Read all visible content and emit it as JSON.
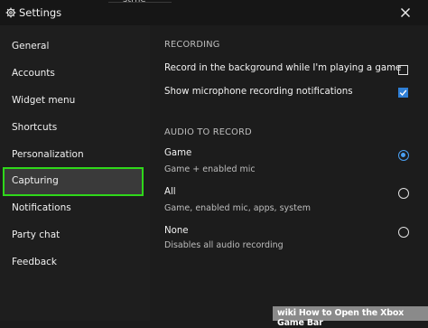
{
  "window": {
    "title": "Settings",
    "top_cut_text": "strne"
  },
  "sidebar": {
    "items": [
      {
        "label": "General"
      },
      {
        "label": "Accounts"
      },
      {
        "label": "Widget menu"
      },
      {
        "label": "Shortcuts"
      },
      {
        "label": "Personalization"
      },
      {
        "label": "Capturing",
        "selected": true
      },
      {
        "label": "Notifications"
      },
      {
        "label": "Party chat"
      },
      {
        "label": "Feedback"
      }
    ]
  },
  "recording": {
    "header": "RECORDING",
    "background_label": "Record in the background while I'm playing a game",
    "background_checked": false,
    "mic_notifications_label": "Show microphone recording notifications",
    "mic_notifications_checked": true
  },
  "audio": {
    "header": "AUDIO TO RECORD",
    "options": [
      {
        "label": "Game",
        "description": "Game + enabled mic",
        "selected": true
      },
      {
        "label": "All",
        "description": "Game, enabled mic, apps, system",
        "selected": false
      },
      {
        "label": "None",
        "description": "Disables all audio recording",
        "selected": false
      }
    ]
  },
  "watermark": {
    "brand": "wiki",
    "text": "How to Open the Xbox Game Bar"
  },
  "colors": {
    "highlight_border": "#2fd81a",
    "accent": "#2f7fd6",
    "background": "#1c1c1c"
  }
}
